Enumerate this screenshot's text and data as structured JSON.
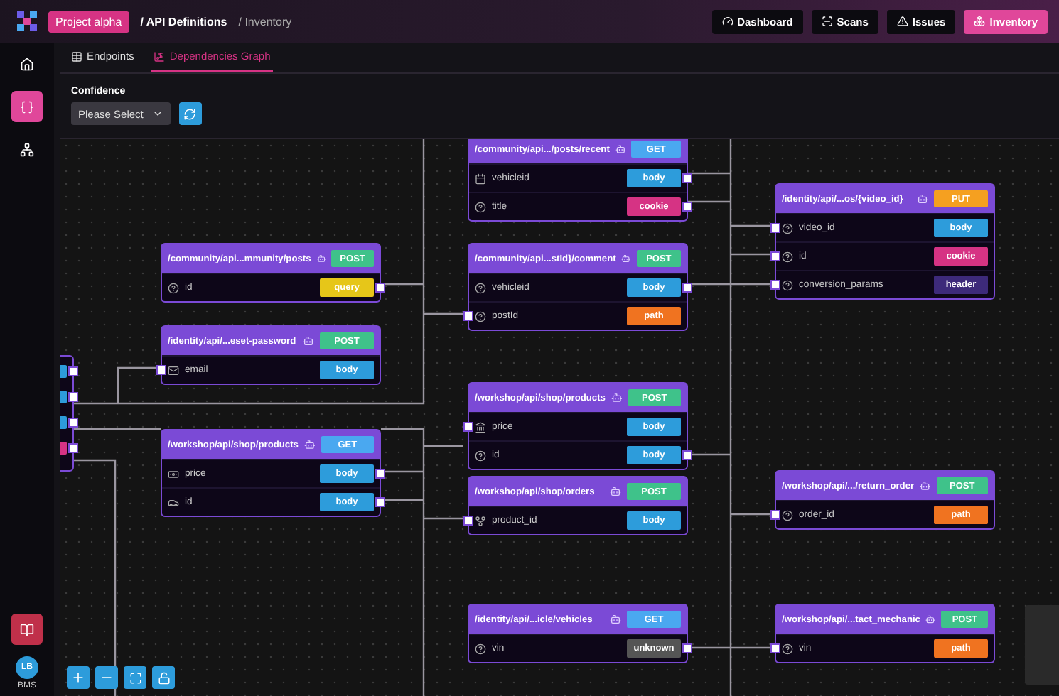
{
  "top_bar": {
    "project": "Project alpha",
    "breadcrumb": [
      {
        "label": "/ API Definitions",
        "current": false
      },
      {
        "label": "/ Inventory",
        "current": true
      }
    ],
    "nav": [
      {
        "label": "Dashboard",
        "kind": "dashboard",
        "selected": false
      },
      {
        "label": "Scans",
        "kind": "scans",
        "selected": false
      },
      {
        "label": "Issues",
        "kind": "issues",
        "selected": false
      },
      {
        "label": "Inventory",
        "kind": "inventory",
        "selected": true
      }
    ]
  },
  "sidebar": {
    "items": [
      {
        "kind": "home",
        "selected": false
      },
      {
        "kind": "api",
        "selected": true
      },
      {
        "kind": "tree",
        "selected": false
      }
    ],
    "user": {
      "initials": "LB",
      "org": "BMS"
    }
  },
  "tabs": [
    {
      "label": "Endpoints",
      "kind": "table",
      "selected": false
    },
    {
      "label": "Dependencies Graph",
      "kind": "graph",
      "selected": true
    }
  ],
  "filter": {
    "label": "Confidence",
    "placeholder": "Please Select"
  },
  "partial_node": {
    "params": [
      {
        "color": "#2d9cdb"
      },
      {
        "color": "#2d9cdb"
      },
      {
        "color": "#2d9cdb"
      },
      {
        "color": "#d63384"
      }
    ]
  },
  "nodes": [
    {
      "path": "/community/api.../posts/recent",
      "method": {
        "label": "GET",
        "color": "#4aa8f0"
      },
      "params": [
        {
          "name": "vehicleid",
          "kind": "calendar",
          "location": "body",
          "color": "#2d9cdb",
          "input": false,
          "output": true
        },
        {
          "name": "title",
          "kind": "help",
          "location": "cookie",
          "color": "#d63384",
          "input": false,
          "output": true
        }
      ]
    },
    {
      "path": "/community/api...mmunity/posts",
      "method": {
        "label": "POST",
        "color": "#3fc28a"
      },
      "params": [
        {
          "name": "id",
          "kind": "help",
          "location": "query",
          "color": "#e6c619",
          "input": false,
          "output": true
        }
      ]
    },
    {
      "path": "/identity/api/...eset-password",
      "method": {
        "label": "POST",
        "color": "#3fc28a"
      },
      "params": [
        {
          "name": "email",
          "kind": "mail",
          "location": "body",
          "color": "#2d9cdb",
          "input": true,
          "output": false
        }
      ]
    },
    {
      "path": "/community/api...stId}/comment",
      "method": {
        "label": "POST",
        "color": "#3fc28a"
      },
      "params": [
        {
          "name": "vehicleid",
          "kind": "help",
          "location": "body",
          "color": "#2d9cdb",
          "input": false,
          "output": true
        },
        {
          "name": "postId",
          "kind": "help",
          "location": "path",
          "color": "#f07320",
          "input": true,
          "output": false
        }
      ]
    },
    {
      "path": "/identity/api/...os/{video_id}",
      "method": {
        "label": "PUT",
        "color": "#f5a020"
      },
      "params": [
        {
          "name": "video_id",
          "kind": "help",
          "location": "body",
          "color": "#2d9cdb",
          "input": true,
          "output": false
        },
        {
          "name": "id",
          "kind": "help",
          "location": "cookie",
          "color": "#d63384",
          "input": true,
          "output": false
        },
        {
          "name": "conversion_params",
          "kind": "help",
          "location": "header",
          "color": "#3d2a7a",
          "input": true,
          "output": false
        }
      ]
    },
    {
      "path": "/workshop/api/shop/products",
      "method": {
        "label": "POST",
        "color": "#3fc28a"
      },
      "params": [
        {
          "name": "price",
          "kind": "landmark",
          "location": "body",
          "color": "#2d9cdb",
          "input": true,
          "output": false
        },
        {
          "name": "id",
          "kind": "help",
          "location": "body",
          "color": "#2d9cdb",
          "input": false,
          "output": true
        }
      ]
    },
    {
      "path": "/workshop/api/shop/products",
      "method": {
        "label": "GET",
        "color": "#4aa8f0"
      },
      "params": [
        {
          "name": "price",
          "kind": "banknote",
          "location": "body",
          "color": "#2d9cdb",
          "input": false,
          "output": true
        },
        {
          "name": "id",
          "kind": "car",
          "location": "body",
          "color": "#2d9cdb",
          "input": false,
          "output": true
        }
      ]
    },
    {
      "path": "/workshop/api/shop/orders",
      "method": {
        "label": "POST",
        "color": "#3fc28a"
      },
      "params": [
        {
          "name": "product_id",
          "kind": "branch",
          "location": "body",
          "color": "#2d9cdb",
          "input": true,
          "output": false
        }
      ]
    },
    {
      "path": "/workshop/api/.../return_order",
      "method": {
        "label": "POST",
        "color": "#3fc28a"
      },
      "params": [
        {
          "name": "order_id",
          "kind": "help",
          "location": "path",
          "color": "#f07320",
          "input": true,
          "output": false
        }
      ]
    },
    {
      "path": "/identity/api/...icle/vehicles",
      "method": {
        "label": "GET",
        "color": "#4aa8f0"
      },
      "params": [
        {
          "name": "vin",
          "kind": "help",
          "location": "unknown",
          "color": "#555555",
          "input": false,
          "output": true
        }
      ]
    },
    {
      "path": "/workshop/api/...tact_mechanic",
      "method": {
        "label": "POST",
        "color": "#3fc28a"
      },
      "params": [
        {
          "name": "vin",
          "kind": "help",
          "location": "path",
          "color": "#f07320",
          "input": true,
          "output": false
        }
      ]
    }
  ]
}
